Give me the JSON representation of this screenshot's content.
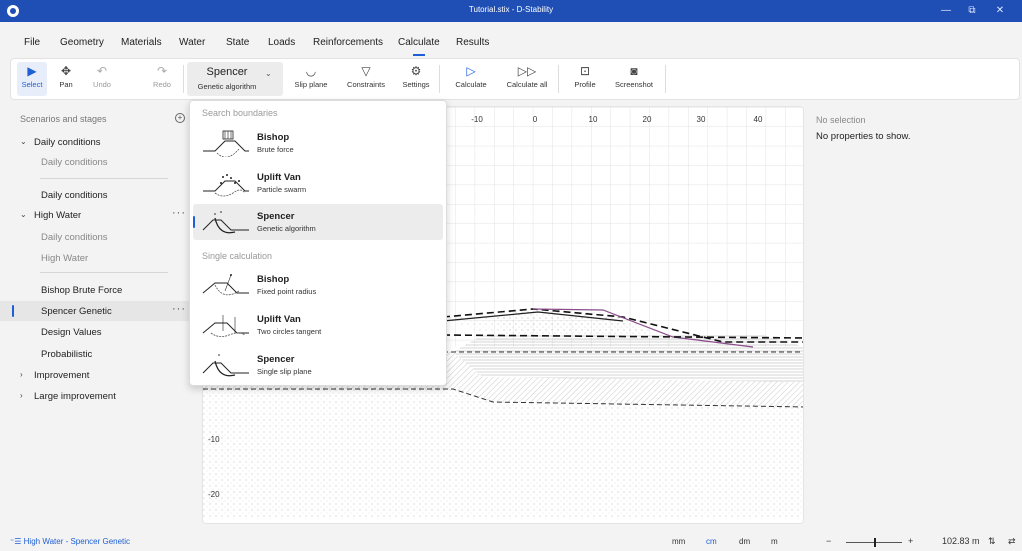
{
  "window": {
    "title": "Tutorial.stix - D-Stability",
    "minimize": "—",
    "maximize": "⧉",
    "close": "✕"
  },
  "menu": {
    "items": [
      "File",
      "Geometry",
      "Materials",
      "Water",
      "State",
      "Loads",
      "Reinforcements",
      "Calculate",
      "Results"
    ],
    "active": "Calculate"
  },
  "ribbon": {
    "select": "Select",
    "pan": "Pan",
    "undo": "Undo",
    "redo": "Redo",
    "method_title": "Spencer",
    "method_sub": "Genetic algorithm",
    "slip_plane": "Slip plane",
    "constraints": "Constraints",
    "settings": "Settings",
    "calculate": "Calculate",
    "calculate_all": "Calculate all",
    "profile": "Profile",
    "screenshot": "Screenshot"
  },
  "scenarios": {
    "header": "Scenarios and stages",
    "rows": [
      {
        "label": "Daily conditions",
        "level": 0,
        "expanded": true
      },
      {
        "label": "Daily conditions",
        "level": 1,
        "muted": true
      },
      {
        "label": "Daily conditions",
        "level": 1
      },
      {
        "label": "High Water",
        "level": 0,
        "expanded": true,
        "more": true
      },
      {
        "label": "Daily conditions",
        "level": 1,
        "muted": true
      },
      {
        "label": "High Water",
        "level": 1,
        "muted": true
      },
      {
        "label": "Bishop Brute Force",
        "level": 1
      },
      {
        "label": "Spencer Genetic",
        "level": 1,
        "selected": true,
        "more": true
      },
      {
        "label": "Design Values",
        "level": 1
      },
      {
        "label": "Probabilistic",
        "level": 1
      },
      {
        "label": "Improvement",
        "level": 0,
        "collapsed": true
      },
      {
        "label": "Large improvement",
        "level": 0,
        "collapsed": true
      }
    ]
  },
  "dropdown": {
    "section1": "Search boundaries",
    "section2": "Single calculation",
    "items": [
      {
        "title": "Bishop",
        "sub": "Brute force"
      },
      {
        "title": "Uplift Van",
        "sub": "Particle swarm"
      },
      {
        "title": "Spencer",
        "sub": "Genetic algorithm",
        "selected": true
      },
      {
        "title": "Bishop",
        "sub": "Fixed point radius"
      },
      {
        "title": "Uplift Van",
        "sub": "Two circles tangent"
      },
      {
        "title": "Spencer",
        "sub": "Single slip plane"
      }
    ]
  },
  "canvas": {
    "x_ticks": [
      "-10",
      "0",
      "10",
      "20",
      "30",
      "40"
    ],
    "y_ticks": [
      "-10",
      "-20"
    ]
  },
  "properties": {
    "header": "No selection",
    "text": "No properties to show."
  },
  "status": {
    "context_icon": "⁼☰",
    "context": "High Water - Spencer Genetic",
    "units": [
      "mm",
      "cm",
      "dm",
      "m"
    ],
    "active_unit": "cm",
    "zoom_minus": "−",
    "zoom_plus": "+",
    "zoom_value": "102.83 m",
    "sym1": "⇅",
    "sym2": "⇄"
  }
}
